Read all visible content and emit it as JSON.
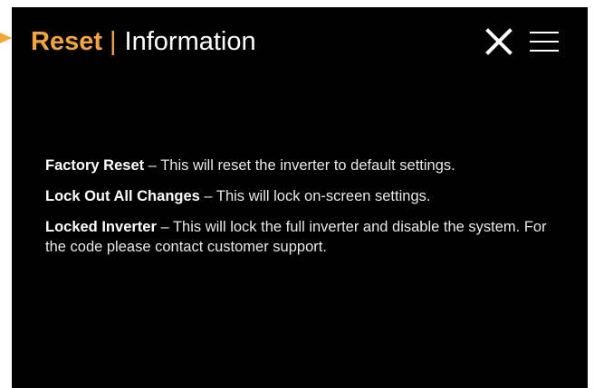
{
  "header": {
    "title_accent": "Reset",
    "separator": "|",
    "title": "Information"
  },
  "icons": {
    "close": "close-icon",
    "menu": "menu-icon",
    "pointer": "pointer-arrow-icon"
  },
  "info": [
    {
      "term": "Factory Reset",
      "description": " – This will reset the inverter to default settings."
    },
    {
      "term": "Lock Out All Changes",
      "description": " – This will lock on-screen settings."
    },
    {
      "term": "Locked Inverter",
      "description": " – This will lock the full inverter and disable the system. For the code please contact customer support."
    }
  ],
  "colors": {
    "accent": "#f6a530",
    "background": "#000000",
    "text": "#ffffff"
  }
}
